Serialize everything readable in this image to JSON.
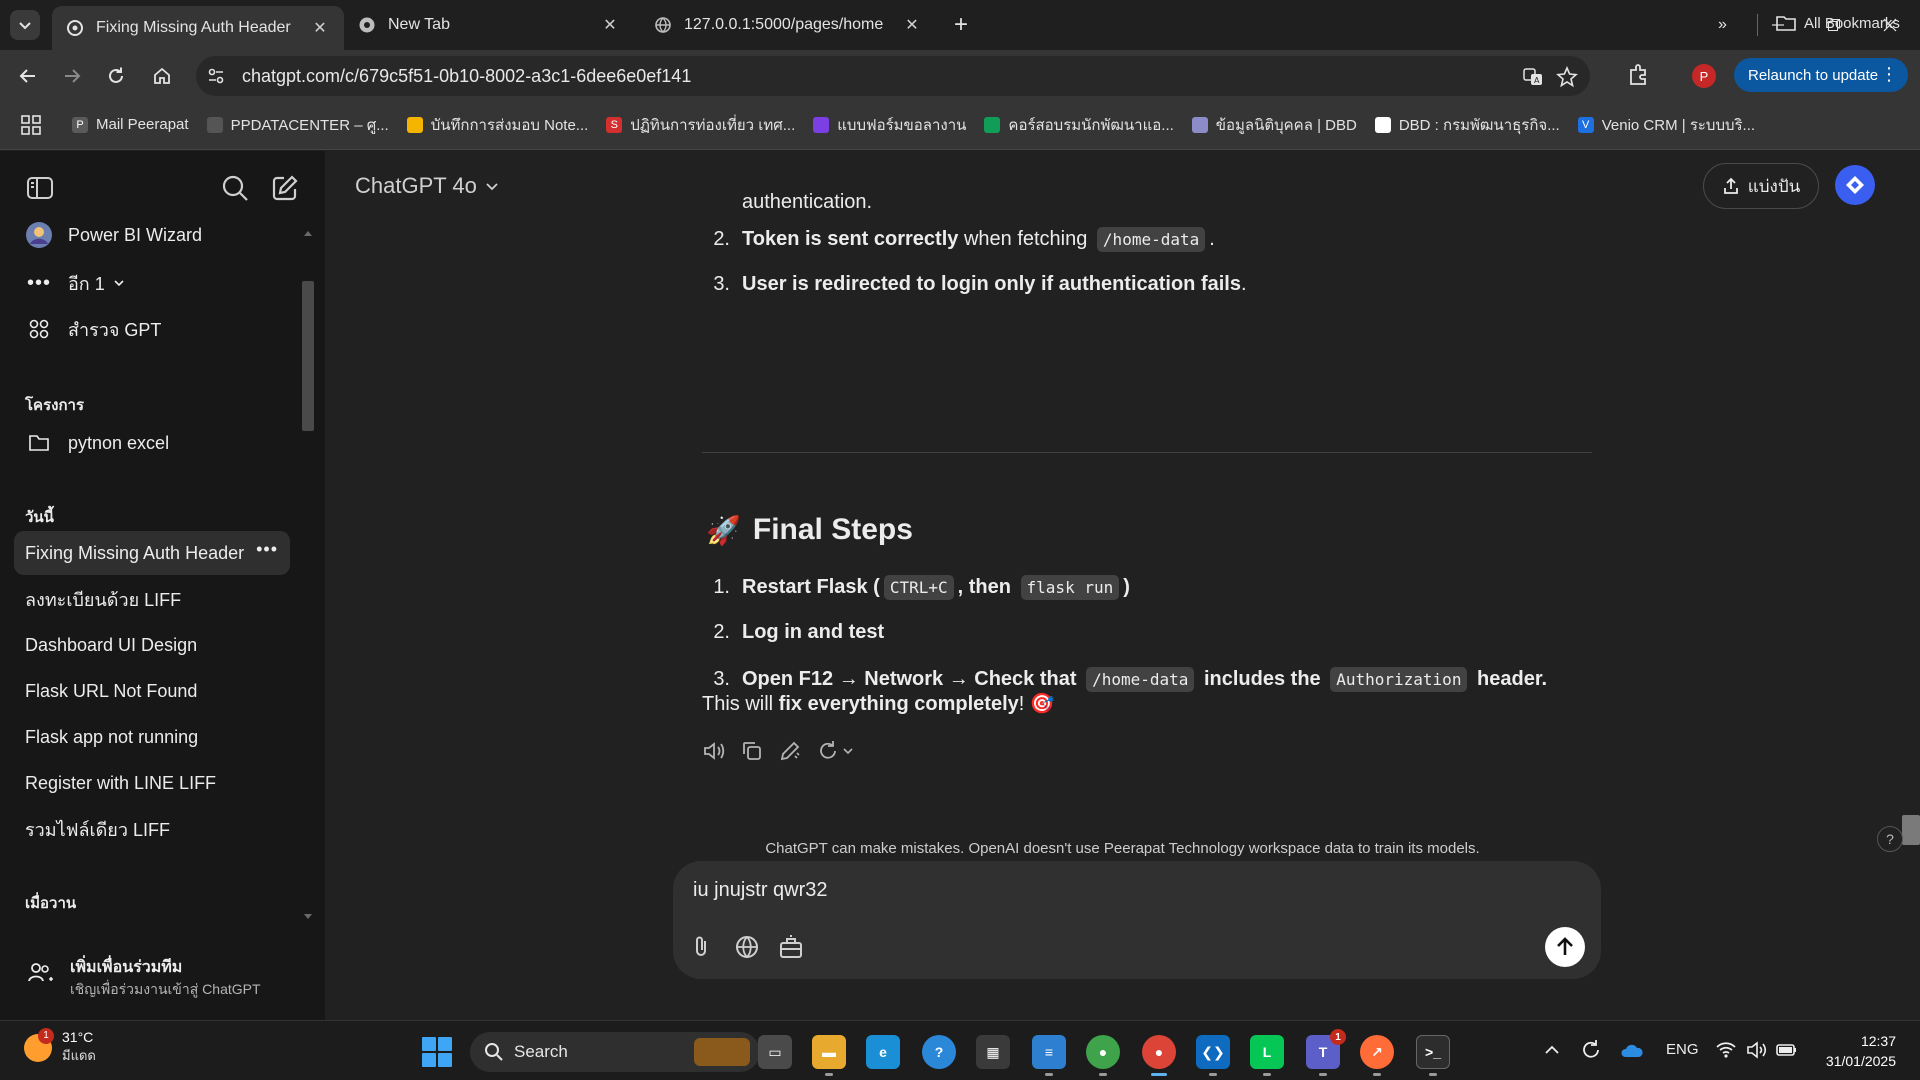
{
  "browser": {
    "tabs": [
      {
        "title": "Fixing Missing Auth Header",
        "active": true
      },
      {
        "title": "New Tab",
        "active": false
      },
      {
        "title": "127.0.0.1:5000/pages/home",
        "active": false
      }
    ],
    "url": "chatgpt.com/c/679c5f51-0b10-8002-a3c1-6dee6e0ef141",
    "profile_initial": "P",
    "relaunch_label": "Relaunch to update",
    "bookmarks": [
      {
        "label": "Mail Peerapat",
        "icon": "P",
        "color": "#5a5a5a"
      },
      {
        "label": "PPDATACENTER – ศู...",
        "icon": "globe-icon",
        "color": "#555555"
      },
      {
        "label": "บันทึกการส่งมอบ Note...",
        "icon": "drive-icon",
        "color": "#f4b400"
      },
      {
        "label": "ปฏิทินการท่องเที่ยว เทศ...",
        "icon": "S",
        "color": "#d32f2f"
      },
      {
        "label": "แบบฟอร์มขอลางาน",
        "icon": "form-icon",
        "color": "#7b3fe4"
      },
      {
        "label": "คอร์สอบรมนักพัฒนาแอ...",
        "icon": "drive-icon",
        "color": "#0f9d58"
      },
      {
        "label": "ข้อมูลนิติบุคคล | DBD",
        "icon": "cube-icon",
        "color": "#8c8cc8"
      },
      {
        "label": "DBD : กรมพัฒนาธุรกิจ...",
        "icon": "dbd-icon",
        "color": "#ffffff"
      },
      {
        "label": "Venio CRM | ระบบบริ...",
        "icon": "V",
        "color": "#1e6fe0"
      }
    ],
    "bookmarks_more": "»",
    "all_bookmarks_label": "All Bookmarks"
  },
  "sidebar": {
    "gpts": [
      {
        "label": "Power BI Wizard",
        "icon": "powerbi-avatar"
      },
      {
        "label": "อีก 1",
        "icon": "more-dots-icon"
      },
      {
        "label": "สำรวจ GPT",
        "icon": "grid-icon"
      }
    ],
    "projects_heading": "โครงการ",
    "projects": [
      {
        "label": "pytnon excel",
        "icon": "folder-icon"
      }
    ],
    "today_heading": "วันนี้",
    "today_chats": [
      {
        "label": "Fixing Missing Auth Header",
        "active": true
      },
      {
        "label": "ลงทะเบียนด้วย LIFF",
        "active": false
      },
      {
        "label": "Dashboard UI Design",
        "active": false
      },
      {
        "label": "Flask URL Not Found",
        "active": false
      },
      {
        "label": "Flask app not running",
        "active": false
      },
      {
        "label": "Register with LINE LIFF",
        "active": false
      },
      {
        "label": "รวมไฟล์เดียว LIFF",
        "active": false
      }
    ],
    "yesterday_heading": "เมื่อวาน",
    "team_title": "เพิ่มเพื่อนร่วมทีม",
    "team_subtitle": "เชิญเพื่อร่วมงานเข้าสู่ ChatGPT"
  },
  "header": {
    "model": "ChatGPT 4o",
    "share_label": "แบ่งปัน"
  },
  "conversation": {
    "prev_tail": "authentication.",
    "list_a": [
      {
        "num": "2.",
        "bold": "Token is sent correctly",
        "rest": " when fetching ",
        "code": "/home-data",
        "tail": "."
      },
      {
        "num": "3.",
        "bold": "User is redirected to login only if authentication fails",
        "rest": ".",
        "code": "",
        "tail": ""
      }
    ],
    "heading_icon": "rocket-emoji",
    "heading": "Final Steps",
    "steps": [
      {
        "num": "1.",
        "parts": [
          "Restart Flask (",
          "CTRL+C",
          ", then ",
          "flask run",
          ")"
        ]
      },
      {
        "num": "2.",
        "parts": [
          "Log in and test"
        ]
      },
      {
        "num": "3.",
        "parts": [
          "Open F12 → Network → Check that ",
          "/home-data",
          " includes the ",
          "Authorization",
          " header."
        ]
      }
    ],
    "closing_plain": "This will ",
    "closing_bold": "fix everything completely",
    "closing_tail": "! 🎯"
  },
  "composer": {
    "value": "iu jnujstr qwr32"
  },
  "disclaimer": "ChatGPT can make mistakes. OpenAI doesn't use Peerapat Technology workspace data to train its models.",
  "help_label": "?",
  "taskbar": {
    "weather_temp": "31°C",
    "weather_desc": "มีแดด",
    "weather_badge": "1",
    "search_label": "Search",
    "tray_lang": "ENG",
    "time": "12:37",
    "date": "31/01/2025",
    "teams_badge": "1"
  }
}
